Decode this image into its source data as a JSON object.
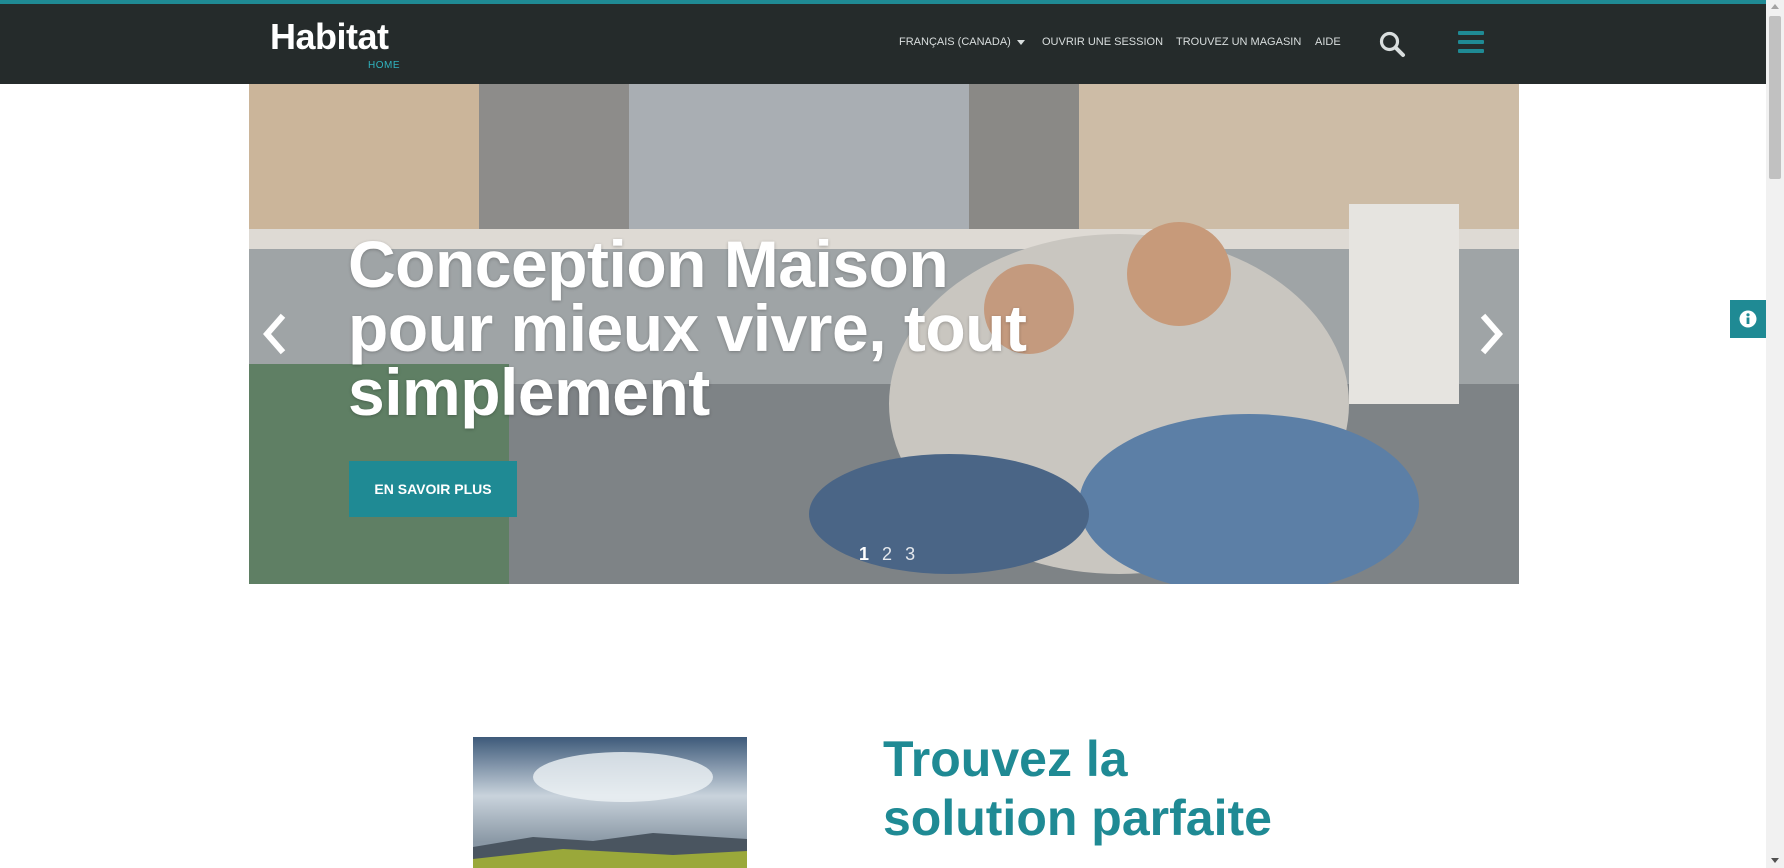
{
  "header": {
    "logo": {
      "main": "Habitat",
      "sub": "HOME"
    },
    "nav": {
      "language": "FRANÇAIS (CANADA)",
      "login": "OUVRIR UNE SESSION",
      "store": "TROUVEZ UN MAGASIN",
      "help": "AIDE"
    },
    "icons": {
      "search": "search-icon",
      "menu": "hamburger-menu-icon"
    }
  },
  "hero": {
    "title": "Conception Maison pour mieux vivre, tout simplement",
    "button": "EN SAVOIR PLUS",
    "slides": [
      "1",
      "2",
      "3"
    ],
    "active_slide": "1",
    "arrows": {
      "prev": "chevron-left-icon",
      "next": "chevron-right-icon"
    }
  },
  "info_tab": {
    "icon": "info-icon"
  },
  "section": {
    "heading": "Trouvez la solution parfaite"
  },
  "colors": {
    "accent": "#1f8a94",
    "header_bg": "#252b2b"
  }
}
